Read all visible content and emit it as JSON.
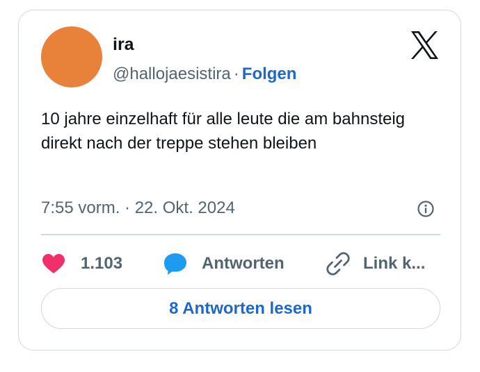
{
  "author": {
    "name": "ira",
    "handle": "@hallojaesistira",
    "separator": "·",
    "follow_label": "Folgen",
    "avatar_color": "#e8813a"
  },
  "tweet": {
    "text": "10 jahre einzelhaft für alle leute die am bahnsteig direkt nach der treppe stehen bleiben",
    "timestamp": "7:55 vorm. · 22. Okt. 2024"
  },
  "actions": {
    "likes": "1.103",
    "reply_label": "Antworten",
    "link_label": "Link k..."
  },
  "read_replies_label": "8 Antworten lesen",
  "icons": {
    "logo": "x-logo-icon",
    "info": "info-icon",
    "like": "heart-icon",
    "reply": "speech-bubble-icon",
    "link": "link-icon"
  },
  "colors": {
    "accent": "#1d68c9",
    "heart": "#f0306a",
    "reply_bubble": "#1d9bf0",
    "muted_text": "#536471",
    "border": "#cfd9de"
  }
}
